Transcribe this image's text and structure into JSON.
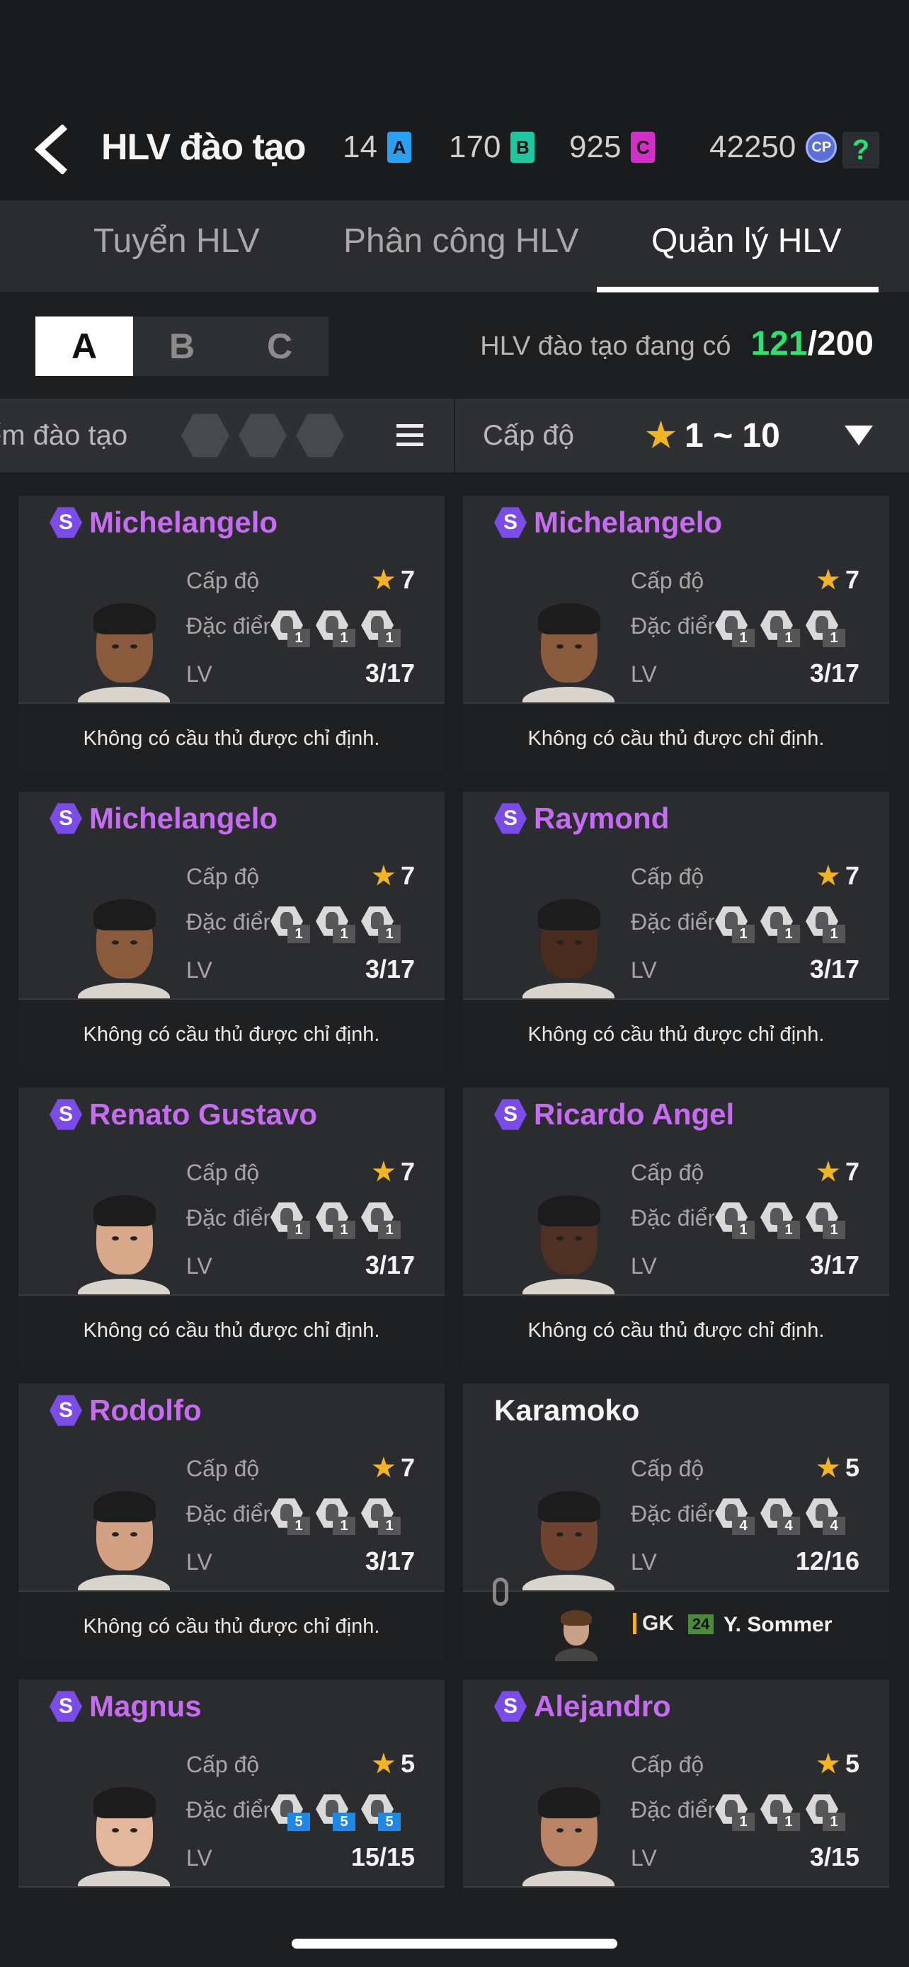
{
  "header": {
    "title": "HLV đào tạo",
    "currencies": [
      {
        "value": "14",
        "token": "A",
        "color": "#2b9ff2"
      },
      {
        "value": "170",
        "token": "B",
        "color": "#1fc7a0"
      },
      {
        "value": "925",
        "token": "C",
        "color": "#d22fc8"
      },
      {
        "value": "42250",
        "token": "CP",
        "color": "#5b6ed6"
      }
    ],
    "help": "?"
  },
  "tabs": [
    {
      "label": "Tuyển HLV",
      "active": false
    },
    {
      "label": "Phân công HLV",
      "active": false
    },
    {
      "label": "Quản lý HLV",
      "active": true
    }
  ],
  "segments": [
    {
      "label": "A",
      "active": true
    },
    {
      "label": "B",
      "active": false
    },
    {
      "label": "C",
      "active": false
    }
  ],
  "count": {
    "label": "HLV đào tạo đang có",
    "current": "121",
    "max": "/200"
  },
  "filter": {
    "sort_label": "ểm đào tạo",
    "level_label": "Cấp độ",
    "level_range": "1 ~ 10"
  },
  "labels": {
    "level": "Cấp độ",
    "traits": "Đặc điểm",
    "lv": "LV",
    "no_player": "Không có cầu thủ được chỉ định."
  },
  "coaches": [
    {
      "name": "Michelangelo",
      "special": true,
      "stars": "7",
      "lv": "3/17",
      "traits": [
        "1",
        "1",
        "1"
      ],
      "skin": "#8a5a3c"
    },
    {
      "name": "Michelangelo",
      "special": true,
      "stars": "7",
      "lv": "3/17",
      "traits": [
        "1",
        "1",
        "1"
      ],
      "skin": "#8a5a3c"
    },
    {
      "name": "Michelangelo",
      "special": true,
      "stars": "7",
      "lv": "3/17",
      "traits": [
        "1",
        "1",
        "1"
      ],
      "skin": "#8a5a3c"
    },
    {
      "name": "Raymond",
      "special": true,
      "stars": "7",
      "lv": "3/17",
      "traits": [
        "1",
        "1",
        "1"
      ],
      "skin": "#4a2c1e"
    },
    {
      "name": "Renato Gustavo",
      "special": true,
      "stars": "7",
      "lv": "3/17",
      "traits": [
        "1",
        "1",
        "1"
      ],
      "skin": "#d7a98a"
    },
    {
      "name": "Ricardo Angel",
      "special": true,
      "stars": "7",
      "lv": "3/17",
      "traits": [
        "1",
        "1",
        "1"
      ],
      "skin": "#4e3024"
    },
    {
      "name": "Rodolfo",
      "special": true,
      "stars": "7",
      "lv": "3/17",
      "traits": [
        "1",
        "1",
        "1"
      ],
      "skin": "#d2a184"
    },
    {
      "name": "Karamoko",
      "special": false,
      "stars": "5",
      "lv": "12/16",
      "traits": [
        "4",
        "4",
        "4"
      ],
      "skin": "#6e4330",
      "assigned": {
        "position": "GK",
        "ovr": "24",
        "player": "Y. Sommer"
      }
    },
    {
      "name": "Magnus",
      "special": true,
      "stars": "5",
      "lv": "15/15",
      "traits": [
        "5",
        "5",
        "5"
      ],
      "skin": "#e2b79c",
      "blue": true
    },
    {
      "name": "Alejandro",
      "special": true,
      "stars": "5",
      "lv": "3/15",
      "traits": [
        "1",
        "1",
        "1"
      ],
      "skin": "#b98466"
    }
  ]
}
